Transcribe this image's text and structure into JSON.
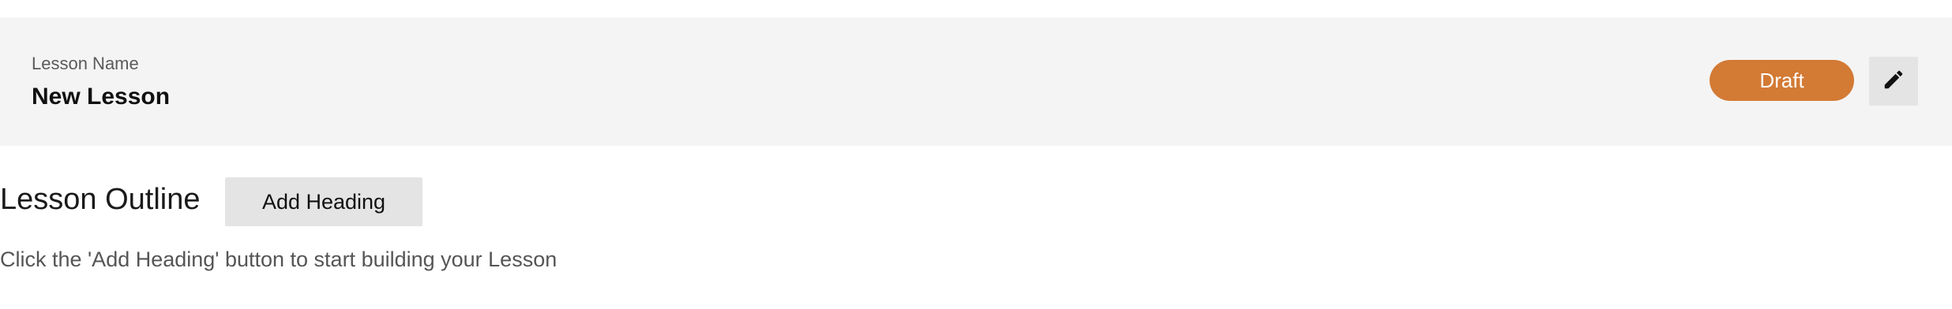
{
  "lesson": {
    "name_label": "Lesson Name",
    "name_value": "New Lesson",
    "status": "Draft",
    "status_color": "#d37a35",
    "edit_icon": "pencil-icon"
  },
  "outline": {
    "title": "Lesson Outline",
    "add_heading_label": "Add Heading",
    "empty_hint": "Click the 'Add Heading' button to start building your Lesson"
  }
}
